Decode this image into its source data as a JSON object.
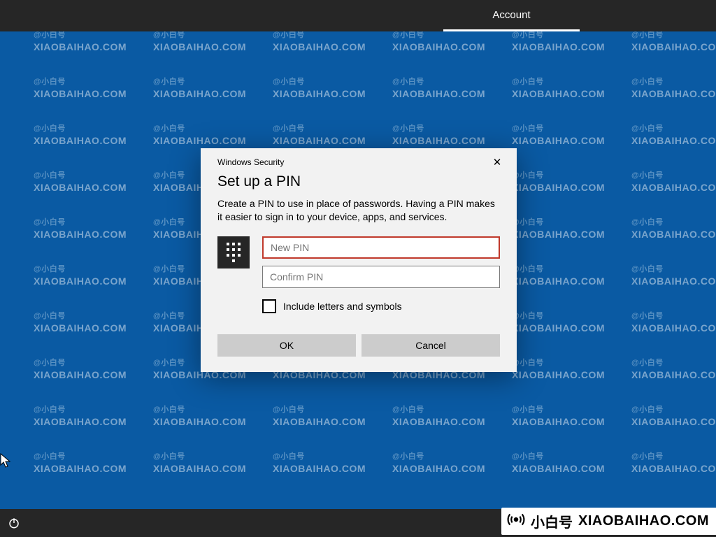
{
  "topbar": {
    "account_label": "Account"
  },
  "dialog": {
    "header_label": "Windows Security",
    "close_glyph": "✕",
    "title": "Set up a PIN",
    "body": "Create a PIN to use in place of passwords. Having a PIN makes it easier to sign in to your device, apps, and services.",
    "new_pin_placeholder": "New PIN",
    "confirm_pin_placeholder": "Confirm PIN",
    "checkbox_label": "Include letters and symbols",
    "ok_label": "OK",
    "cancel_label": "Cancel"
  },
  "watermark": {
    "small": "@小白号",
    "big": "XIAOBAIHAO.COM"
  },
  "brand": {
    "cn": "小白号",
    "en": "XIAOBAIHAO.COM"
  }
}
